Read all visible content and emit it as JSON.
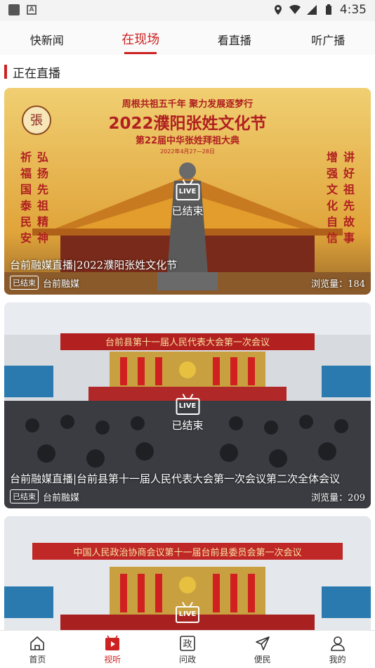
{
  "status_bar": {
    "time": "4:35"
  },
  "top_tabs": [
    "快新闻",
    "在现场",
    "看直播",
    "听广播"
  ],
  "active_top_tab": 1,
  "section_title": "正在直播",
  "cards": [
    {
      "live_label": "LIVE",
      "status": "已结束",
      "title": "台前融媒直播|2022濮阳张姓文化节",
      "badge": "已结束",
      "source": "台前融媒",
      "views": "浏览量：184",
      "poster": {
        "slogan": "周根共祖五千年 聚力发展逐梦行",
        "headline": "2022濮阳张姓文化节",
        "subheadline": "第22届中华张姓拜祖大典",
        "date": "2022年4月27—28日",
        "left_cols": [
          "弘扬先祖精神",
          "祈福国泰民安"
        ],
        "right_cols": [
          "增强文化自信",
          "讲好祖先故事"
        ]
      }
    },
    {
      "live_label": "LIVE",
      "status": "已结束",
      "title": "台前融媒直播|台前县第十一届人民代表大会第一次会议第二次全体会议",
      "badge": "已结束",
      "source": "台前融媒",
      "views": "浏览量：209",
      "banner": "台前县第十一届人民代表大会第一次会议"
    },
    {
      "live_label": "LIVE",
      "banner": "中国人民政治协商会议第十一届台前县委员会第一次会议"
    }
  ],
  "bottom_nav": [
    {
      "label": "首页",
      "icon": "home-icon"
    },
    {
      "label": "视听",
      "icon": "video-play-icon"
    },
    {
      "label": "问政",
      "icon": "politics-icon"
    },
    {
      "label": "便民",
      "icon": "send-icon"
    },
    {
      "label": "我的",
      "icon": "user-icon"
    }
  ],
  "active_bottom": 1,
  "colors": {
    "accent": "#cc2222",
    "poster_bg": "#e8b84a",
    "hall_red": "#b32020"
  }
}
